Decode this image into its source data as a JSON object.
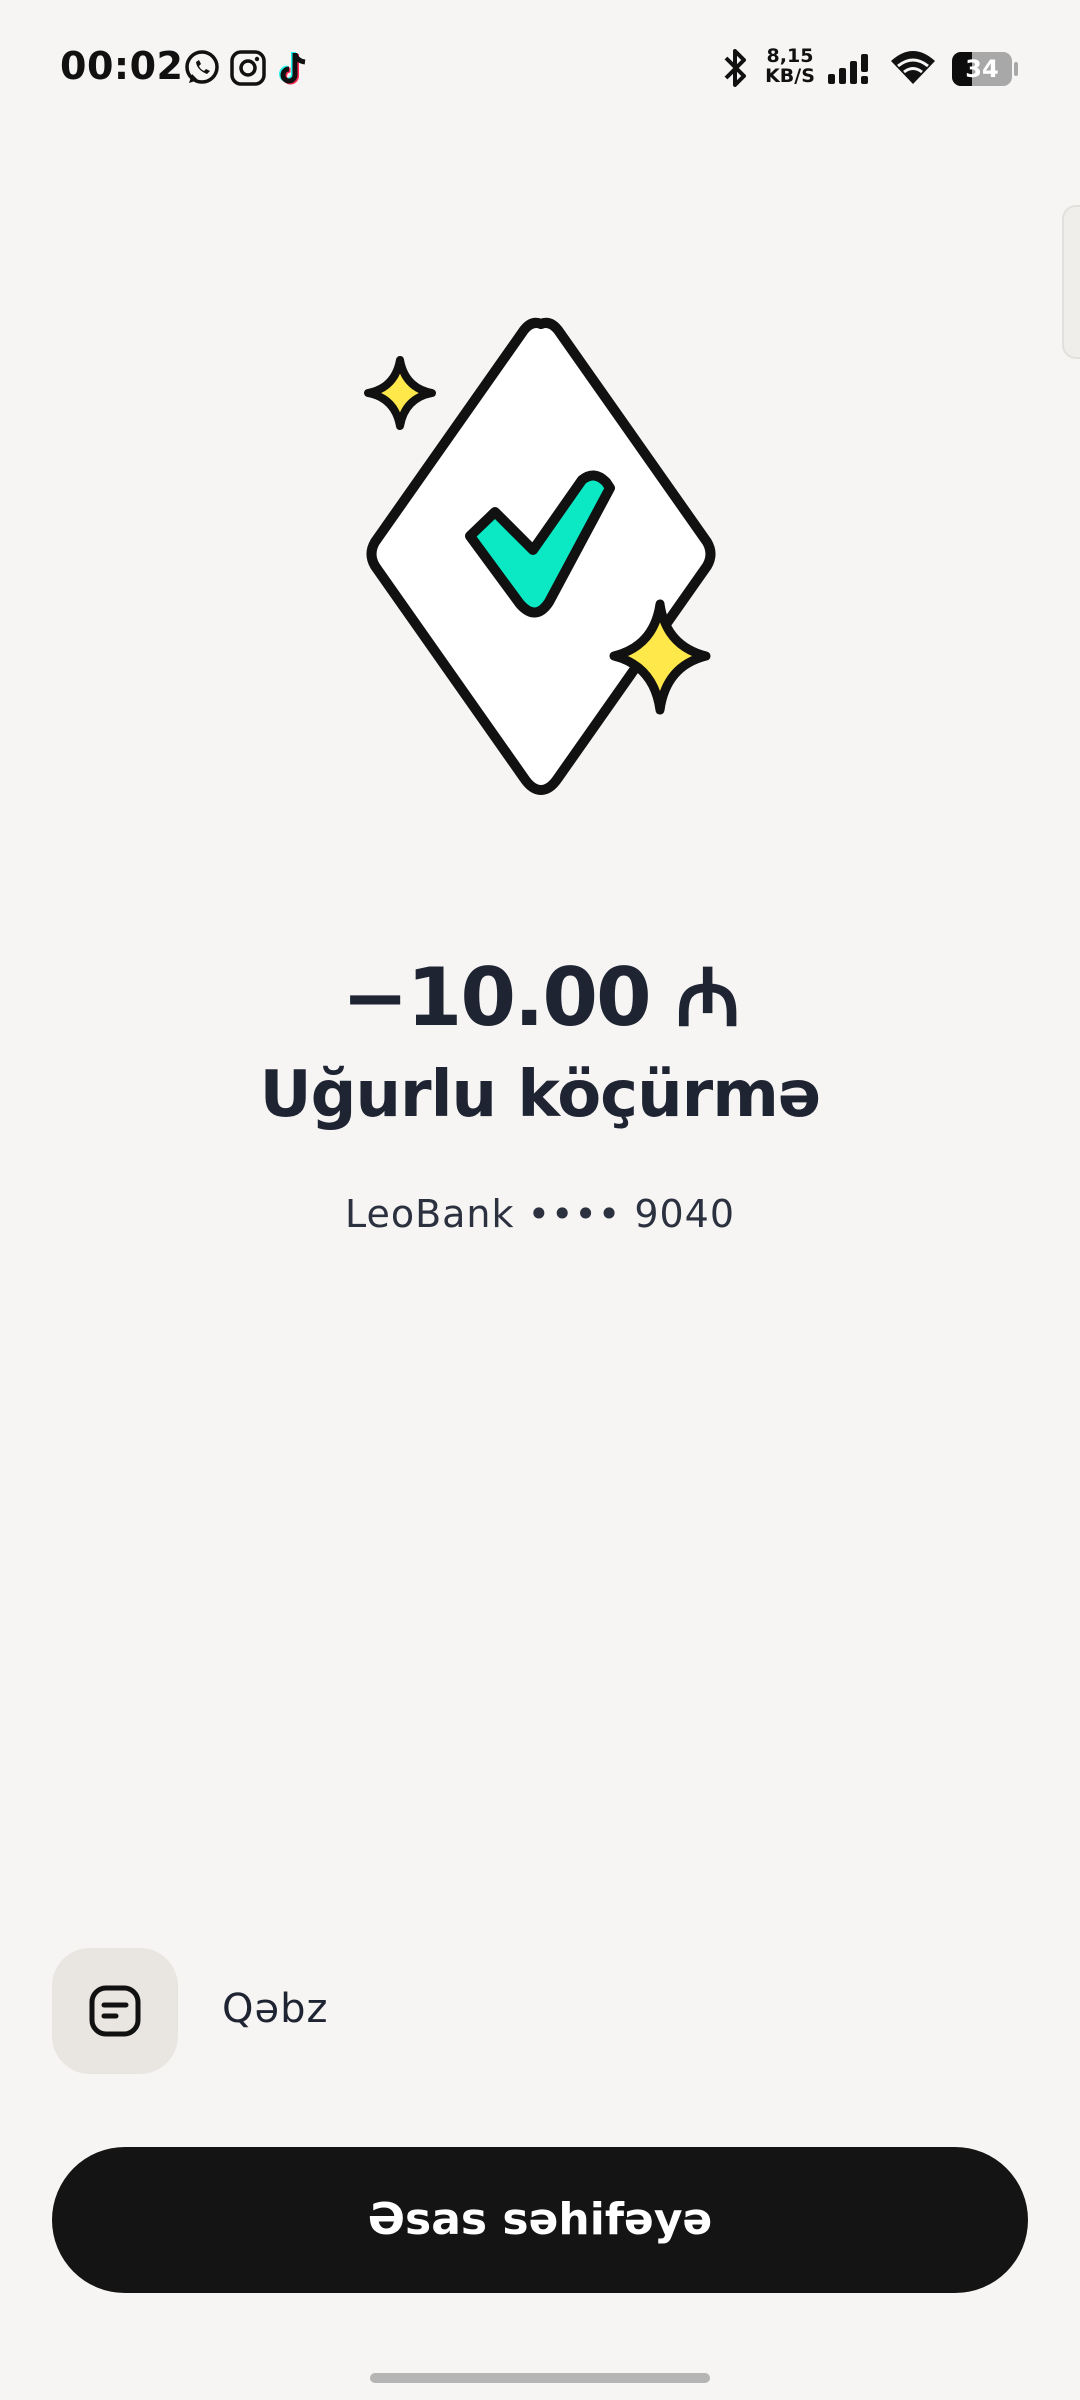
{
  "status_bar": {
    "time": "00:02",
    "network_speed_value": "8,15",
    "network_speed_unit": "KB/S",
    "battery_level": "34",
    "battery_fraction": 0.34,
    "app_icons": [
      "whatsapp-icon",
      "instagram-icon",
      "tiktok-icon"
    ],
    "system_icons": [
      "bluetooth-icon",
      "signal-icon",
      "wifi-icon",
      "battery-icon"
    ]
  },
  "result": {
    "amount": "−10.00 ₼",
    "title": "Uğurlu köçürmə",
    "account": "LeoBank •••• 9040",
    "illustration": "success-checkmark-illustration"
  },
  "actions": {
    "receipt_label": "Qəbz",
    "receipt_icon": "receipt-icon",
    "home_button_label": "Əsas səhifəyə"
  },
  "colors": {
    "background": "#f6f5f3",
    "check": "#0ae8c4",
    "sparkle": "#ffe94a",
    "button": "#141414",
    "text": "#1f2433"
  }
}
